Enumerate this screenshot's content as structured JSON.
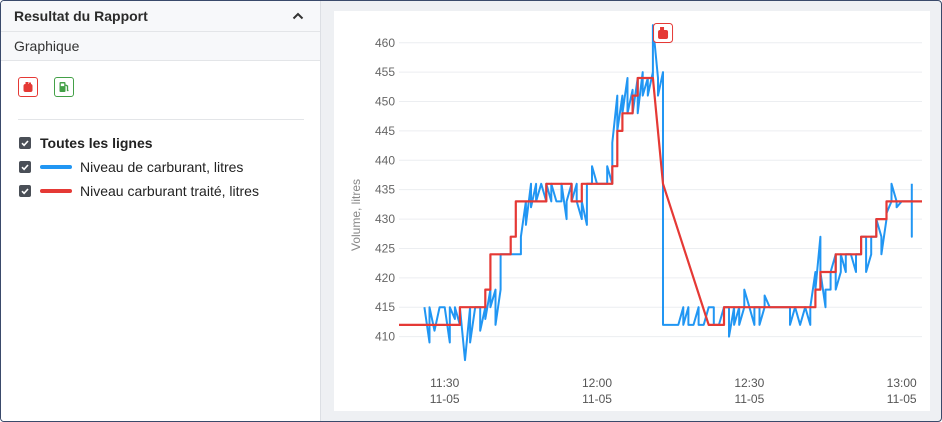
{
  "panel": {
    "title": "Resultat du Rapport",
    "subtitle": "Graphique"
  },
  "events": [
    {
      "icon": "fuel-drain-icon",
      "color": "#e53935"
    },
    {
      "icon": "fuel-station-icon",
      "color": "#43a047"
    }
  ],
  "legend": {
    "all": "Toutes les lignes",
    "items": [
      {
        "label": "Niveau de carburant, litres",
        "color": "#2196f3"
      },
      {
        "label": "Niveau carburant traité, litres",
        "color": "#e53935"
      }
    ]
  },
  "chart_data": {
    "type": "line",
    "ylabel": "Volume, litres",
    "ylim": [
      405,
      462
    ],
    "yticks": [
      410,
      415,
      420,
      425,
      430,
      435,
      440,
      445,
      450,
      455,
      460
    ],
    "xlim": [
      "11:21",
      "13:04"
    ],
    "xticks": [
      {
        "x": "11:30",
        "time": "11:30",
        "date": "11-05"
      },
      {
        "x": "12:00",
        "time": "12:00",
        "date": "11-05"
      },
      {
        "x": "12:30",
        "time": "12:30",
        "date": "11-05"
      },
      {
        "x": "13:00",
        "time": "13:00",
        "date": "11-05"
      }
    ],
    "grid": true,
    "annotations": [
      {
        "type": "event",
        "icon": "fuel-drain-icon",
        "x": "12:13"
      }
    ],
    "series": [
      {
        "name": "Niveau de carburant, litres",
        "color": "#2196f3",
        "points": [
          [
            "11:26",
            415
          ],
          [
            "11:27",
            409
          ],
          [
            "11:27",
            415
          ],
          [
            "11:28",
            411
          ],
          [
            "11:29",
            415
          ],
          [
            "11:30",
            415
          ],
          [
            "11:31",
            409
          ],
          [
            "11:31",
            415
          ],
          [
            "11:32",
            413
          ],
          [
            "11:32",
            415
          ],
          [
            "11:33",
            412
          ],
          [
            "11:33",
            415
          ],
          [
            "11:34",
            406
          ],
          [
            "11:35",
            415
          ],
          [
            "11:35",
            409
          ],
          [
            "11:36",
            415
          ],
          [
            "11:37",
            415
          ],
          [
            "11:37",
            411
          ],
          [
            "11:38",
            415
          ],
          [
            "11:38",
            413
          ],
          [
            "11:39",
            418
          ],
          [
            "11:39",
            415
          ],
          [
            "11:40",
            418
          ],
          [
            "11:40",
            412
          ],
          [
            "11:41",
            418
          ],
          [
            "11:41",
            424
          ],
          [
            "11:42",
            424
          ],
          [
            "11:43",
            424
          ],
          [
            "11:43",
            424
          ],
          [
            "11:44",
            424
          ],
          [
            "11:45",
            424
          ],
          [
            "11:45",
            427
          ],
          [
            "11:46",
            433
          ],
          [
            "11:46",
            429
          ],
          [
            "11:47",
            436
          ],
          [
            "11:47",
            432
          ],
          [
            "11:48",
            436
          ],
          [
            "11:48",
            433
          ],
          [
            "11:49",
            436
          ],
          [
            "11:50",
            433
          ],
          [
            "11:50",
            436
          ],
          [
            "11:51",
            433
          ],
          [
            "11:51",
            436
          ],
          [
            "11:52",
            433
          ],
          [
            "11:53",
            433
          ],
          [
            "11:53",
            436
          ],
          [
            "11:54",
            430
          ],
          [
            "11:54",
            433
          ],
          [
            "11:55",
            436
          ],
          [
            "11:55",
            433
          ],
          [
            "11:56",
            436
          ],
          [
            "11:56",
            433
          ],
          [
            "11:57",
            430
          ],
          [
            "11:57",
            433
          ],
          [
            "11:58",
            429
          ],
          [
            "11:58",
            436
          ],
          [
            "11:59",
            436
          ],
          [
            "11:59",
            439
          ],
          [
            "12:00",
            436
          ],
          [
            "12:01",
            436
          ],
          [
            "12:02",
            436
          ],
          [
            "12:02",
            439
          ],
          [
            "12:03",
            436
          ],
          [
            "12:03",
            443
          ],
          [
            "12:04",
            451
          ],
          [
            "12:04",
            445
          ],
          [
            "12:05",
            451
          ],
          [
            "12:05",
            448
          ],
          [
            "12:06",
            454
          ],
          [
            "12:06",
            448
          ],
          [
            "12:07",
            452
          ],
          [
            "12:07",
            448
          ],
          [
            "12:08",
            454
          ],
          [
            "12:08",
            448
          ],
          [
            "12:09",
            455
          ],
          [
            "12:09",
            451
          ],
          [
            "12:10",
            454
          ],
          [
            "12:10",
            451
          ],
          [
            "12:11",
            455
          ],
          [
            "12:11",
            454
          ],
          [
            "12:11",
            463
          ],
          [
            "12:12",
            454
          ],
          [
            "12:12",
            451
          ],
          [
            "12:13",
            455
          ],
          [
            "12:13",
            454
          ],
          [
            "12:13",
            412
          ],
          [
            "12:14",
            412
          ],
          [
            "12:15",
            412
          ],
          [
            "12:16",
            412
          ],
          [
            "12:17",
            415
          ],
          [
            "12:17",
            412
          ],
          [
            "12:18",
            415
          ],
          [
            "12:18",
            412
          ],
          [
            "12:19",
            412
          ],
          [
            "12:20",
            415
          ],
          [
            "12:20",
            412
          ],
          [
            "12:21",
            412
          ],
          [
            "12:22",
            415
          ],
          [
            "12:23",
            415
          ],
          [
            "12:23",
            412
          ],
          [
            "12:24",
            412
          ],
          [
            "12:25",
            415
          ],
          [
            "12:26",
            415
          ],
          [
            "12:26",
            410
          ],
          [
            "12:27",
            415
          ],
          [
            "12:27",
            412
          ],
          [
            "12:28",
            415
          ],
          [
            "12:28",
            412
          ],
          [
            "12:29",
            415
          ],
          [
            "12:29",
            418
          ],
          [
            "12:30",
            415
          ],
          [
            "12:31",
            412
          ],
          [
            "12:31",
            415
          ],
          [
            "12:32",
            415
          ],
          [
            "12:32",
            412
          ],
          [
            "12:33",
            415
          ],
          [
            "12:33",
            417
          ],
          [
            "12:34",
            415
          ],
          [
            "12:35",
            415
          ],
          [
            "12:36",
            415
          ],
          [
            "12:37",
            415
          ],
          [
            "12:38",
            415
          ],
          [
            "12:38",
            412
          ],
          [
            "12:39",
            415
          ],
          [
            "12:40",
            412
          ],
          [
            "12:41",
            415
          ],
          [
            "12:42",
            412
          ],
          [
            "12:42",
            415
          ],
          [
            "12:43",
            421
          ],
          [
            "12:43",
            418
          ],
          [
            "12:44",
            427
          ],
          [
            "12:44",
            421
          ],
          [
            "12:45",
            415
          ],
          [
            "12:45",
            418
          ],
          [
            "12:46",
            418
          ],
          [
            "12:46",
            421
          ],
          [
            "12:47",
            424
          ],
          [
            "12:47",
            418
          ],
          [
            "12:48",
            421
          ],
          [
            "12:48",
            424
          ],
          [
            "12:49",
            421
          ],
          [
            "12:49",
            424
          ],
          [
            "12:50",
            424
          ],
          [
            "12:51",
            421
          ],
          [
            "12:51",
            424
          ],
          [
            "12:52",
            424
          ],
          [
            "12:52",
            427
          ],
          [
            "12:53",
            427
          ],
          [
            "12:53",
            421
          ],
          [
            "12:54",
            424
          ],
          [
            "12:54",
            427
          ],
          [
            "12:55",
            427
          ],
          [
            "12:55",
            430
          ],
          [
            "12:56",
            427
          ],
          [
            "12:56",
            424
          ],
          [
            "12:57",
            430
          ],
          [
            "12:57",
            431
          ],
          [
            "12:58",
            433
          ],
          [
            "12:58",
            436
          ],
          [
            "12:59",
            433
          ],
          [
            "12:59",
            432
          ],
          [
            "13:00",
            433
          ],
          [
            "13:01",
            433
          ],
          [
            "13:02",
            433
          ],
          [
            "13:02",
            427
          ],
          [
            "13:02",
            436
          ]
        ]
      },
      {
        "name": "Niveau carburant traité, litres",
        "color": "#e53935",
        "points": [
          [
            "11:21",
            412
          ],
          [
            "11:33",
            412
          ],
          [
            "11:33",
            415
          ],
          [
            "11:38",
            415
          ],
          [
            "11:38",
            418
          ],
          [
            "11:39",
            418
          ],
          [
            "11:39",
            424
          ],
          [
            "11:43",
            424
          ],
          [
            "11:43",
            427
          ],
          [
            "11:44",
            427
          ],
          [
            "11:44",
            433
          ],
          [
            "11:50",
            433
          ],
          [
            "11:50",
            436
          ],
          [
            "11:55",
            436
          ],
          [
            "11:55",
            433
          ],
          [
            "11:57",
            433
          ],
          [
            "11:57",
            436
          ],
          [
            "12:03",
            436
          ],
          [
            "12:03",
            439
          ],
          [
            "12:04",
            439
          ],
          [
            "12:04",
            445
          ],
          [
            "12:05",
            445
          ],
          [
            "12:05",
            448
          ],
          [
            "12:07",
            448
          ],
          [
            "12:07",
            451
          ],
          [
            "12:08",
            451
          ],
          [
            "12:08",
            454
          ],
          [
            "12:11",
            454
          ],
          [
            "12:13",
            436
          ],
          [
            "12:22",
            412
          ],
          [
            "12:25",
            412
          ],
          [
            "12:25",
            415
          ],
          [
            "12:43",
            415
          ],
          [
            "12:43",
            418
          ],
          [
            "12:44",
            418
          ],
          [
            "12:44",
            421
          ],
          [
            "12:47",
            421
          ],
          [
            "12:47",
            424
          ],
          [
            "12:52",
            424
          ],
          [
            "12:52",
            427
          ],
          [
            "12:55",
            427
          ],
          [
            "12:55",
            430
          ],
          [
            "12:57",
            430
          ],
          [
            "12:57",
            433
          ],
          [
            "13:04",
            433
          ]
        ]
      }
    ]
  }
}
